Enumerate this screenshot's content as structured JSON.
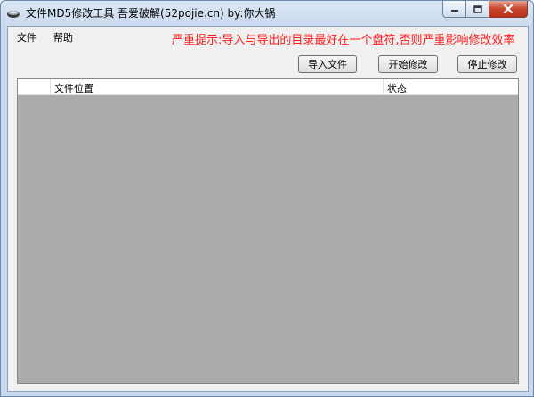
{
  "window": {
    "title": "文件MD5修改工具  吾爱破解(52pojie.cn)   by:你大锅"
  },
  "menu": {
    "items": [
      {
        "label": "文件"
      },
      {
        "label": "帮助"
      }
    ]
  },
  "warning": "严重提示:导入与导出的目录最好在一个盘符,否则严重影响修改效率",
  "buttons": {
    "import_label": "导入文件",
    "start_label": "开始修改",
    "stop_label": "停止修改"
  },
  "list": {
    "columns": [
      {
        "label": ""
      },
      {
        "label": "文件位置"
      },
      {
        "label": "状态"
      }
    ],
    "rows": []
  },
  "colors": {
    "warning": "#ff1a1a",
    "list_background": "#ababab",
    "close_button": "#c7452d"
  }
}
